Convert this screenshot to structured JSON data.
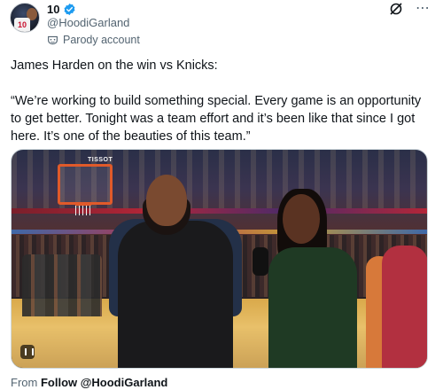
{
  "author": {
    "display_name": "10",
    "handle": "@HoodiGarland",
    "verified": true,
    "avatar_jersey_number": "10",
    "parody_label": "Parody account"
  },
  "post": {
    "line1": "James Harden on the win vs Knicks:",
    "line2": "“We’re working to build something special. Every game is an opportunity to get better. Tonight was a team effort and it’s been like that since I got here. It’s one of the beauties of this team.”"
  },
  "media": {
    "scoreboard_text": "TISSOT"
  },
  "footer": {
    "from_label": "From",
    "follow_label": "Follow @HoodiGarland"
  },
  "colors": {
    "verified_blue": "#1d9bf0",
    "muted_text": "#536471"
  },
  "icons": {
    "verified": "verified-badge-icon",
    "parody": "parody-mask-icon",
    "grok": "grok-icon",
    "more": "more-options-icon",
    "gif": "gif-badge-icon"
  }
}
